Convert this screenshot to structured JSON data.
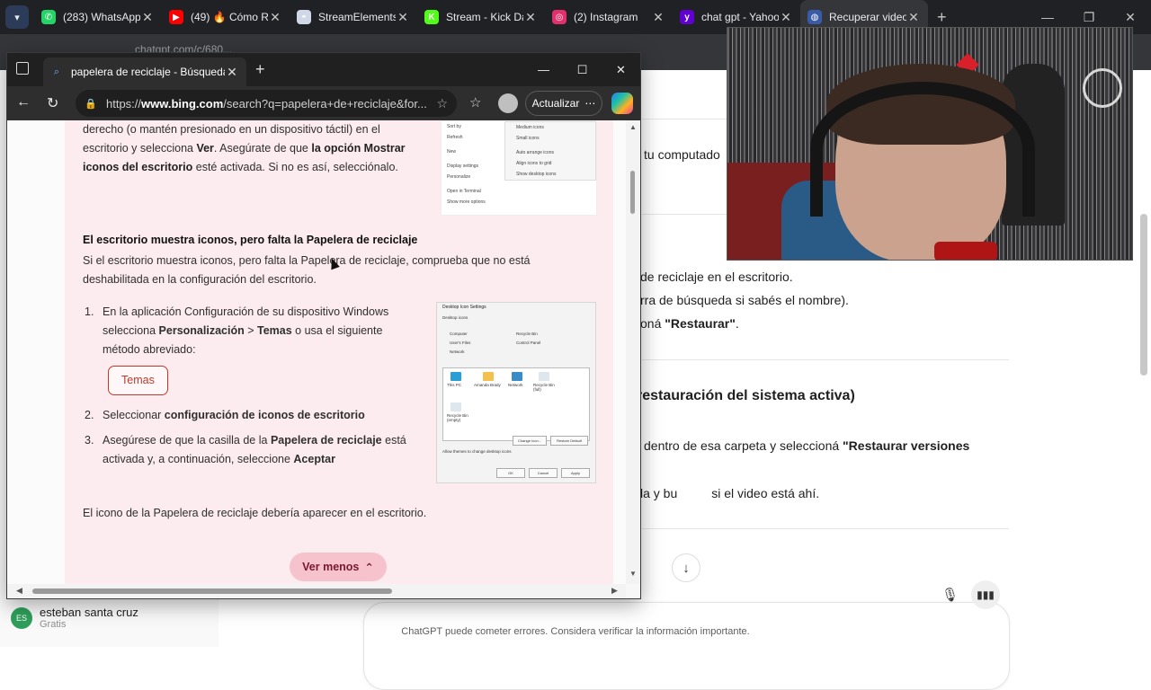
{
  "outer_browser": {
    "tabs": [
      {
        "title": "(283) WhatsApp",
        "icon": "whatsapp-icon",
        "color": "#25d366",
        "glyph": "✆"
      },
      {
        "title": "(49) 🔥 Cómo R",
        "icon": "youtube-icon",
        "color": "#ff0000",
        "glyph": "▶"
      },
      {
        "title": "StreamElements",
        "icon": "streamelements-icon",
        "color": "#d0d7e6",
        "glyph": "◓"
      },
      {
        "title": "Stream - Kick Da",
        "icon": "kick-icon",
        "color": "#53fc18",
        "glyph": "K"
      },
      {
        "title": "(2) Instagram",
        "icon": "instagram-icon",
        "color": "#e1306c",
        "glyph": "◎"
      },
      {
        "title": "chat gpt - Yahoo",
        "icon": "yahoo-icon",
        "color": "#6001d2",
        "glyph": "y"
      },
      {
        "title": "Recuperar video",
        "icon": "chatgpt-icon",
        "color": "#3a5ba8",
        "glyph": "◍"
      }
    ],
    "url_fragment": "chatgpt.com/c/680..."
  },
  "chatgpt_page": {
    "lines": [
      {
        "text": "tu computado",
        "bold": ""
      },
      {
        "text": "de reciclaje en el escritorio.",
        "bold": ""
      },
      {
        "text": "rra de búsqueda si sabés el nombre).",
        "bold": ""
      },
      {
        "text": "oná ",
        "bold": "\"Restaurar\"",
        "tail": "."
      },
      {
        "text": "dentro de esa carpeta y seleccioná ",
        "bold": "\"Restaurar versiones",
        "tail": ""
      },
      {
        "text": "la y bu",
        "bold": "",
        "tail": "si el video está ahí."
      }
    ],
    "heading": "restauración del sistema activa)",
    "disclaimer": "ChatGPT puede cometer errores. Considera verificar la información importante.",
    "user": {
      "initials": "ES",
      "name": "esteban santa cruz",
      "plan": "Gratis"
    }
  },
  "edge_window": {
    "tab_title": "papelera de reciclaje - Búsqueda",
    "url_prefix": "https://",
    "url_host": "www.bing.com",
    "url_rest": "/search?q=papelera+de+reciclaje&for...",
    "update_label": "Actualizar",
    "update_more": "⋯"
  },
  "bing_result": {
    "para1_a": "derecho (o mantén presionado en un dispositivo táctil) en el escritorio y selecciona ",
    "para1_b": "Ver",
    "para1_c": ". Asegúrate de que ",
    "para1_d": "la opción Mostrar iconos del escritorio",
    "para1_e": " esté activada. Si no es así, selecciónalo.",
    "heading": "El escritorio muestra iconos, pero falta la Papelera de reciclaje",
    "para2": "Si el escritorio muestra iconos, pero falta la Papelera de reciclaje, comprueba que no está deshabilitada en la configuración del escritorio.",
    "steps": [
      {
        "num": "1.",
        "a": "En la aplicación Configuración de su dispositivo Windows selecciona ",
        "b": "Personalización",
        "c": " > ",
        "d": "Temas",
        "e": " o usa el siguiente método abreviado:"
      },
      {
        "num": "2.",
        "a": "Seleccionar ",
        "b": "configuración de iconos de escritorio",
        "c": "",
        "d": "",
        "e": ""
      },
      {
        "num": "3.",
        "a": "Asegúrese de que la casilla de la ",
        "b": "Papelera de reciclaje",
        "c": " está activada y, a continuación, seleccione ",
        "d": "Aceptar",
        "e": ""
      }
    ],
    "temas_button": "Temas",
    "footer": "El icono de la Papelera de reciclaje debería aparecer en el escritorio.",
    "ver_menos": "Ver menos",
    "thumb1_menu": [
      "Sort by",
      "Refresh",
      "",
      "New",
      "",
      "Display settings",
      "Personalize",
      "",
      "Open in Terminal",
      "Show more options"
    ],
    "thumb1_sub": [
      "Medium icons",
      "Small icons",
      "",
      "Auto arrange icons",
      "Align icons to grid",
      "Show desktop icons"
    ],
    "thumb2_title": "Desktop Icon Settings",
    "thumb2_labels": [
      "Desktop icons",
      "Computer",
      "Recycle Bin",
      "User's Files",
      "Control Panel",
      "Network"
    ],
    "thumb2_icons": [
      "This PC",
      "Amanda Brady",
      "Network",
      "Recycle Bin (full)",
      "Recycle Bin (empty)"
    ],
    "thumb2_buttons": [
      "Change Icon...",
      "Restore Default",
      "OK",
      "Cancel",
      "Apply"
    ],
    "thumb2_check": "Allow themes to change desktop icons"
  }
}
